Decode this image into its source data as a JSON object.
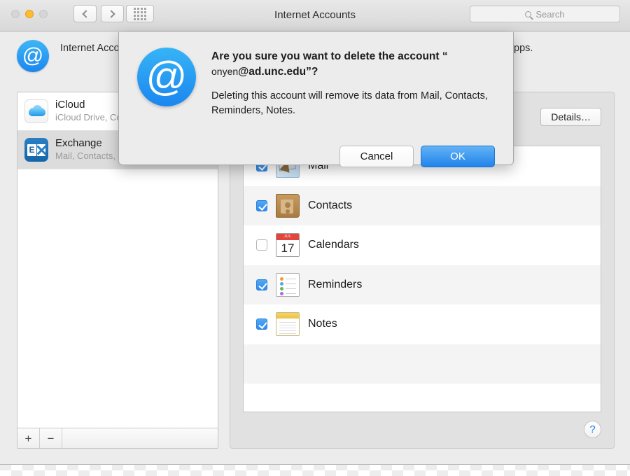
{
  "window": {
    "title": "Internet Accounts",
    "traffic_lights": [
      {
        "name": "close",
        "state": "disabled"
      },
      {
        "name": "minimize",
        "state": "active"
      },
      {
        "name": "zoom",
        "state": "disabled"
      }
    ],
    "search": {
      "placeholder": "Search",
      "value": ""
    }
  },
  "header": {
    "text": "Internet Accounts sets up your accounts to use with Mail, Contacts, Calendar, Messages, and other apps.",
    "icon": "at-sign-icon"
  },
  "sidebar": {
    "accounts": [
      {
        "name": "iCloud",
        "services": "iCloud Drive, Contacts, Calendars and 6 more…",
        "icon": "icloud-icon",
        "selected": false
      },
      {
        "name": "Exchange",
        "services": "Mail, Contacts, Reminders and Notes",
        "icon": "exchange-icon",
        "selected": true
      }
    ],
    "add_label": "+",
    "remove_label": "−"
  },
  "details": {
    "label": "Details…"
  },
  "services": {
    "rows": [
      {
        "label": "Mail",
        "checked": true,
        "icon": "mail-icon"
      },
      {
        "label": "Contacts",
        "checked": true,
        "icon": "contacts-icon"
      },
      {
        "label": "Calendars",
        "checked": false,
        "icon": "calendar-icon"
      },
      {
        "label": "Reminders",
        "checked": true,
        "icon": "reminders-icon"
      },
      {
        "label": "Notes",
        "checked": true,
        "icon": "notes-icon"
      }
    ]
  },
  "calendar_icon": {
    "month": "JUL",
    "day": "17"
  },
  "help": {
    "label": "?"
  },
  "dialog": {
    "icon": "at-sign-icon",
    "title_lead": "Are you sure you want to delete the account",
    "title_quote_open": "“",
    "title_account_user": "onyen",
    "title_account_domain": "@ad.unc.edu”?",
    "message": "Deleting this account will remove its data from Mail, Contacts, Reminders, Notes.",
    "cancel_label": "Cancel",
    "ok_label": "OK"
  },
  "colors": {
    "accent_blue": "#2084ea",
    "window_chrome": "#ececec",
    "selected_row": "#dcdcdc",
    "minimize_yellow": "#febc2e",
    "help_blue": "#1b7ef0",
    "calendar_red": "#e3453c"
  }
}
